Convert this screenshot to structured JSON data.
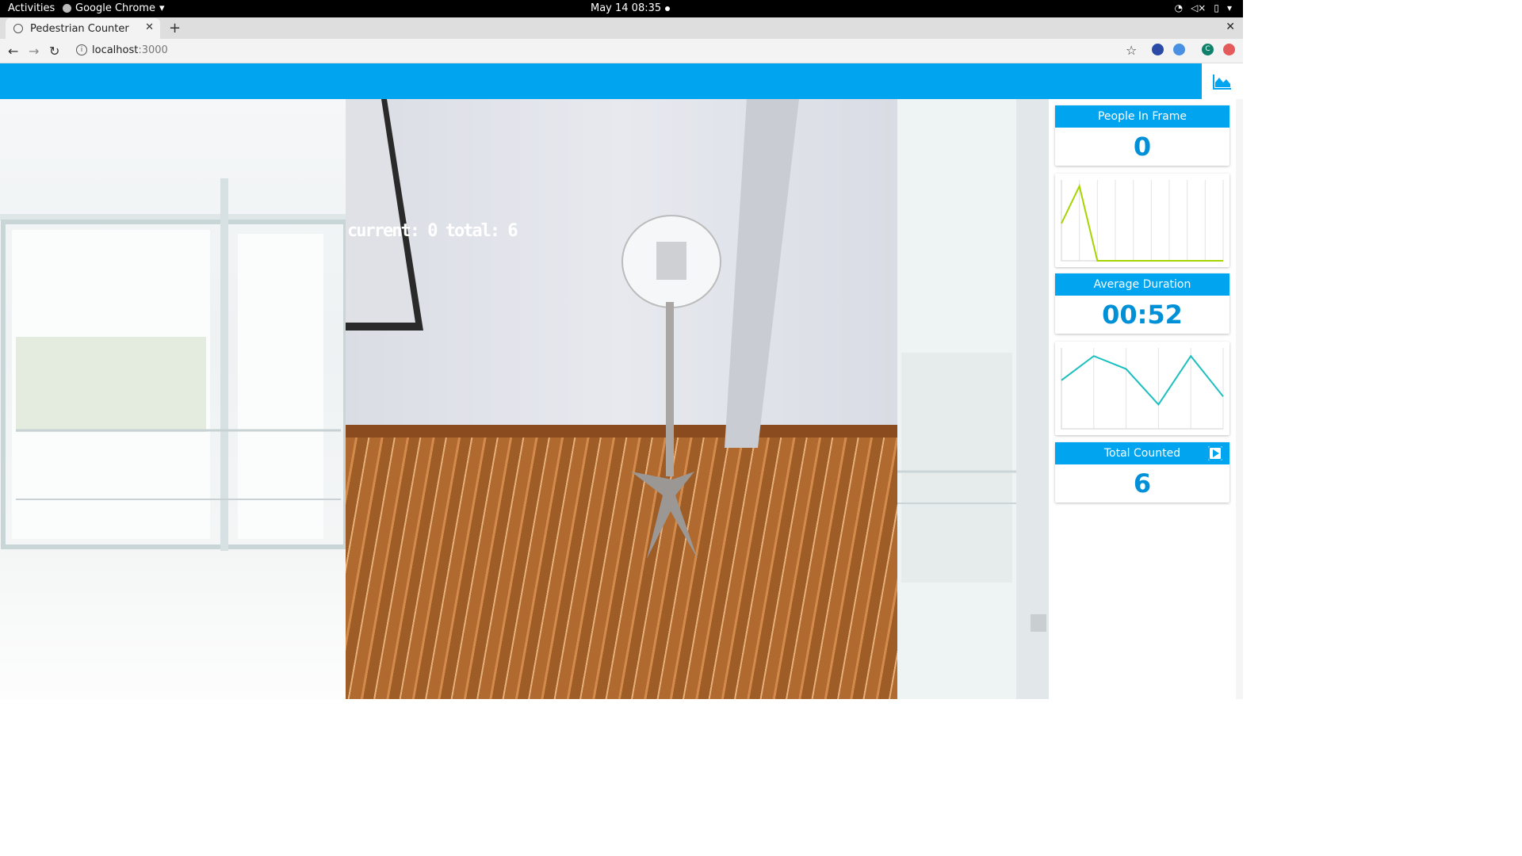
{
  "os_bar": {
    "activities": "Activities",
    "app_name": "Google Chrome",
    "clock": "May 14  08:35"
  },
  "browser": {
    "tab_title": "Pedestrian Counter",
    "url_host": "localhost",
    "url_port": ":3000",
    "profile_initial": "C"
  },
  "video": {
    "overlay_text": "current: 0 total: 6"
  },
  "stats": {
    "people_in_frame": {
      "label": "People In Frame",
      "value": "0"
    },
    "average_duration": {
      "label": "Average Duration",
      "value": "00:52"
    },
    "total_counted": {
      "label": "Total Counted",
      "value": "6"
    }
  },
  "chart_data": [
    {
      "type": "line",
      "series": [
        {
          "values": [
            3.0,
            6.0,
            0.0,
            0.0,
            0.0,
            0.0,
            0.0,
            0.0,
            0.0,
            0.0
          ]
        }
      ],
      "x": [
        0,
        1,
        2,
        3,
        4,
        5,
        6,
        7,
        8,
        9
      ],
      "ylim": [
        0,
        6.5
      ],
      "grid": "vertical",
      "color": "#a6d400"
    },
    {
      "type": "line",
      "series": [
        {
          "values": [
            45,
            60,
            52,
            30,
            60,
            35
          ]
        }
      ],
      "x": [
        0,
        1,
        2,
        3,
        4,
        5
      ],
      "ylim": [
        15,
        65
      ],
      "grid": "vertical",
      "color": "#1bbfbf"
    }
  ],
  "colors": {
    "accent": "#00a4ef",
    "value_text": "#0090d8"
  }
}
